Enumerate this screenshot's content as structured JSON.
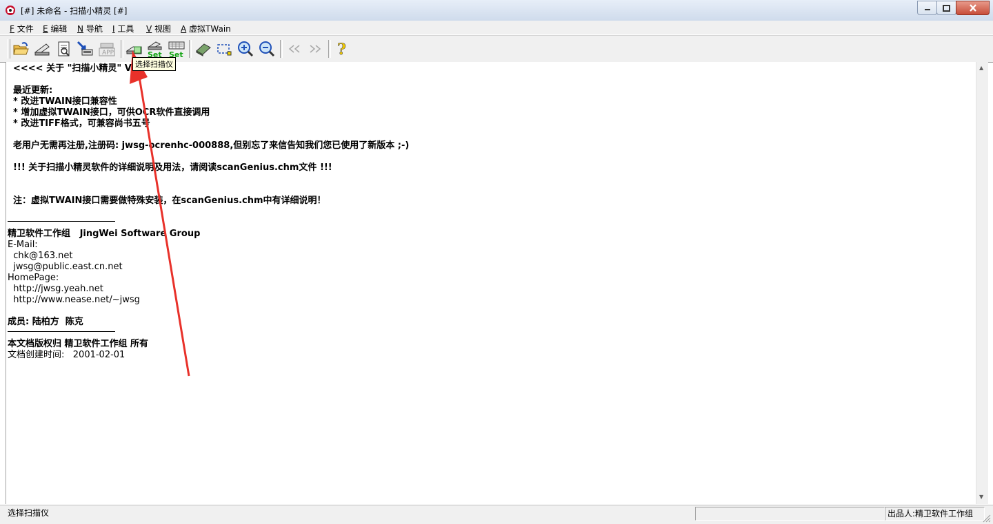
{
  "window": {
    "title": "[#] 未命名 - 扫描小精灵 [#]"
  },
  "menu": [
    {
      "key": "F",
      "label": "文件"
    },
    {
      "key": "E",
      "label": "编辑"
    },
    {
      "key": "N",
      "label": "导航"
    },
    {
      "key": "I",
      "label": "工具"
    },
    {
      "key": "V",
      "label": "视图"
    },
    {
      "key": "A",
      "label": "虚拟TWain"
    }
  ],
  "toolbar": {
    "buttons": [
      "open-icon",
      "scan-icon",
      "preview-icon",
      "acquire-icon",
      "app-icon",
      "select-scanner-icon",
      "scan-set-icon",
      "keyboard-set-icon",
      "eraser-icon",
      "select-rect-icon",
      "zoom-in-icon",
      "zoom-out-icon",
      "prev-icon",
      "next-icon",
      "help-icon"
    ],
    "tooltip": "选择扫描仪"
  },
  "document": {
    "line1": "<<<< 关于 \"扫描小精灵\" V",
    "line1_end": ">",
    "recent_heading": "最近更新:",
    "update1": "* 改进TWAIN接口兼容性",
    "update2": "* 增加虚拟TWAIN接口，可供OCR软件直接调用",
    "update3": "* 改进TIFF格式，可兼容尚书五号",
    "registration": "老用户无需再注册,注册码: jwsg-ocrenhc-000888,但别忘了来信告知我们您已使用了新版本 ;-)",
    "manual_note": "!!! 关于扫描小精灵软件的详细说明及用法，请阅读scanGenius.chm文件 !!!",
    "twain_note": "注：虚拟TWAIN接口需要做特殊安装，在scanGenius.chm中有详细说明！",
    "group": "精卫软件工作组   JingWei Software Group",
    "email_label": "E-Mail:",
    "email1": "  chk@163.net",
    "email2": "  jwsg@public.east.cn.net",
    "homepage_label": "HomePage:",
    "home1": "  http://jwsg.yeah.net",
    "home2": "  http://www.nease.net/~jwsg",
    "members": "成员: 陆柏方  陈克",
    "copyright": "本文档版权归 精卫软件工作组 所有",
    "created": "文档创建时间:   2001-02-01"
  },
  "status": {
    "left": "选择扫描仪",
    "right": "出品人:精卫软件工作组"
  }
}
